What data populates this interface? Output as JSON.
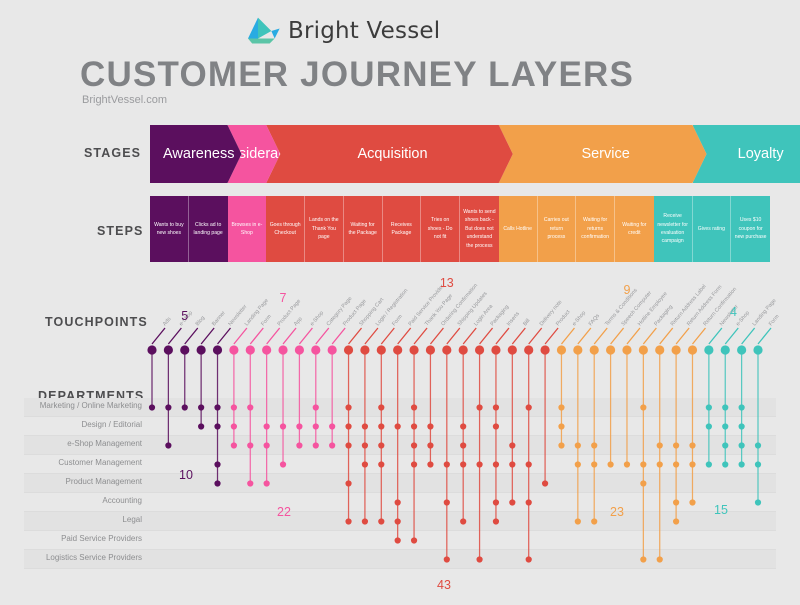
{
  "brand": {
    "logo_text": "Bright Vessel",
    "logo_icon": "sail-boat-icon"
  },
  "header": {
    "title": "CUSTOMER JOURNEY LAYERS",
    "subtitle": "BrightVessel.com"
  },
  "row_labels": {
    "stages": "STAGES",
    "steps": "STEPS",
    "touchpoints": "TOUCHPOINTS",
    "departments": "DEPARTMENTS"
  },
  "colors": {
    "awareness": "#5b0f5e",
    "consideration": "#f5549f",
    "acquisition": "#df4b41",
    "service": "#f2a04a",
    "loyalty": "#3fc4bb",
    "background": "#e8e8e8",
    "title_gray": "#808285",
    "text_gray": "#8d8e90"
  },
  "stages": [
    {
      "label": "Awareness",
      "color": "#5b0f5e",
      "steps": 2
    },
    {
      "label": "Consideration",
      "color": "#f5549f",
      "steps": 1
    },
    {
      "label": "Acquisition",
      "color": "#df4b41",
      "steps": 6
    },
    {
      "label": "Service",
      "color": "#f2a04a",
      "steps": 5
    },
    {
      "label": "Loyalty",
      "color": "#3fc4bb",
      "steps": 3
    }
  ],
  "steps": [
    {
      "label": "Wants to buy new shoes",
      "stage": 0
    },
    {
      "label": "Clicks ad to landing page",
      "stage": 0
    },
    {
      "label": "Browses in e-Shop",
      "stage": 1
    },
    {
      "label": "Goes through Checkout",
      "stage": 2
    },
    {
      "label": "Lands on the Thank You page",
      "stage": 2
    },
    {
      "label": "Waiting for the Package",
      "stage": 2
    },
    {
      "label": "Receives Package",
      "stage": 2
    },
    {
      "label": "Tries on shoes - Do not fit",
      "stage": 2
    },
    {
      "label": "Wants to send shoes back - But does not understand the process",
      "stage": 2
    },
    {
      "label": "Calls Hotline",
      "stage": 3
    },
    {
      "label": "Carries out return process",
      "stage": 3
    },
    {
      "label": "Waiting for returns confirmation",
      "stage": 3
    },
    {
      "label": "Waiting for credit",
      "stage": 3
    },
    {
      "label": "Receive newsletter for evaluation campaign",
      "stage": 4
    },
    {
      "label": "Gives rating",
      "stage": 4
    },
    {
      "label": "Uses $10 coupon for new purchase",
      "stage": 4
    }
  ],
  "touchpoint_counts": [
    {
      "stage": 0,
      "value": "5"
    },
    {
      "stage": 1,
      "value": "7"
    },
    {
      "stage": 2,
      "value": "13"
    },
    {
      "stage": 3,
      "value": "9"
    },
    {
      "stage": 4,
      "value": "4"
    }
  ],
  "department_counts": [
    {
      "stage": 0,
      "value": "10"
    },
    {
      "stage": 1,
      "value": "22"
    },
    {
      "stage": 2,
      "value": "43"
    },
    {
      "stage": 3,
      "value": "23"
    },
    {
      "stage": 4,
      "value": "15"
    }
  ],
  "departments": [
    "Marketing / Online Marketing",
    "Design / Editorial",
    "e-Shop Management",
    "Customer Management",
    "Product Management",
    "Accounting",
    "Legal",
    "Paid Service Providers",
    "Logistics Service Providers"
  ],
  "chart_data": {
    "type": "scatter",
    "title": "CUSTOMER JOURNEY LAYERS",
    "xlabel": "Touchpoints",
    "ylabel": "Departments",
    "grid": true,
    "legend": "none",
    "y_categories": [
      "Marketing / Online Marketing",
      "Design / Editorial",
      "e-Shop Management",
      "Customer Management",
      "Product Management",
      "Accounting",
      "Legal",
      "Paid Service Providers",
      "Logistics Service Providers"
    ],
    "series": [
      {
        "name": "Awareness",
        "color": "#5b0f5e",
        "count": 5,
        "department_links": 10
      },
      {
        "name": "Consideration",
        "color": "#f5549f",
        "count": 7,
        "department_links": 22
      },
      {
        "name": "Acquisition",
        "color": "#df4b41",
        "count": 13,
        "department_links": 43
      },
      {
        "name": "Service",
        "color": "#f2a04a",
        "count": 9,
        "department_links": 23
      },
      {
        "name": "Loyalty",
        "color": "#3fc4bb",
        "count": 4,
        "department_links": 15
      }
    ],
    "touchpoints": [
      {
        "label": "Ads",
        "stage": 0,
        "departments": [
          0
        ]
      },
      {
        "label": "e-Shop",
        "stage": 0,
        "departments": [
          0,
          2
        ]
      },
      {
        "label": "Blog",
        "stage": 0,
        "departments": [
          0
        ]
      },
      {
        "label": "Banner",
        "stage": 0,
        "departments": [
          0,
          1
        ]
      },
      {
        "label": "Newsletter",
        "stage": 0,
        "departments": [
          0,
          1,
          3,
          4
        ]
      },
      {
        "label": "Landing Page",
        "stage": 1,
        "departments": [
          0,
          1,
          2
        ]
      },
      {
        "label": "Form",
        "stage": 1,
        "departments": [
          0,
          2,
          4
        ]
      },
      {
        "label": "Product Page",
        "stage": 1,
        "departments": [
          1,
          2,
          4
        ]
      },
      {
        "label": "App",
        "stage": 1,
        "departments": [
          1,
          3
        ]
      },
      {
        "label": "e-Shop",
        "stage": 1,
        "departments": [
          1,
          2
        ]
      },
      {
        "label": "Category Page",
        "stage": 1,
        "departments": [
          0,
          1,
          2
        ]
      },
      {
        "label": "Product Page",
        "stage": 1,
        "departments": [
          1,
          2
        ]
      },
      {
        "label": "Shopping Cart",
        "stage": 2,
        "departments": [
          0,
          1,
          2,
          4,
          6
        ]
      },
      {
        "label": "Login / Registration",
        "stage": 2,
        "departments": [
          1,
          2,
          3,
          6
        ]
      },
      {
        "label": "Form",
        "stage": 2,
        "departments": [
          0,
          1,
          2,
          3,
          6
        ]
      },
      {
        "label": "Paid Service Provider",
        "stage": 2,
        "departments": [
          1,
          5,
          6,
          7
        ]
      },
      {
        "label": "Thank You Page",
        "stage": 2,
        "departments": [
          0,
          1,
          2,
          3,
          7
        ]
      },
      {
        "label": "Ordering Confirmation",
        "stage": 2,
        "departments": [
          1,
          2,
          3
        ]
      },
      {
        "label": "Shipping Updates",
        "stage": 2,
        "departments": [
          3,
          5,
          8
        ]
      },
      {
        "label": "Login Area",
        "stage": 2,
        "departments": [
          1,
          2,
          3,
          6
        ]
      },
      {
        "label": "Packaging",
        "stage": 2,
        "departments": [
          0,
          3,
          8
        ]
      },
      {
        "label": "Inserts",
        "stage": 2,
        "departments": [
          0,
          1,
          3,
          5,
          6
        ]
      },
      {
        "label": "Bill",
        "stage": 2,
        "departments": [
          2,
          3,
          5
        ]
      },
      {
        "label": "Delivery note",
        "stage": 2,
        "departments": [
          0,
          3,
          5,
          8
        ]
      },
      {
        "label": "Product",
        "stage": 2,
        "departments": [
          4
        ]
      },
      {
        "label": "e-Shop",
        "stage": 3,
        "departments": [
          0,
          1,
          2
        ]
      },
      {
        "label": "FAQs",
        "stage": 3,
        "departments": [
          2,
          3,
          6
        ]
      },
      {
        "label": "Terms & Conditions",
        "stage": 3,
        "departments": [
          2,
          3,
          6
        ]
      },
      {
        "label": "Speech Computer",
        "stage": 3,
        "departments": [
          3
        ]
      },
      {
        "label": "Hotline Employee",
        "stage": 3,
        "departments": [
          3
        ]
      },
      {
        "label": "Packaging",
        "stage": 3,
        "departments": [
          0,
          3,
          4,
          8
        ]
      },
      {
        "label": "Return Address Label",
        "stage": 3,
        "departments": [
          2,
          3,
          8
        ]
      },
      {
        "label": "Return Address Form",
        "stage": 3,
        "departments": [
          2,
          3,
          5,
          6
        ]
      },
      {
        "label": "Return Confirmation",
        "stage": 3,
        "departments": [
          2,
          3,
          5
        ]
      },
      {
        "label": "Newsletter",
        "stage": 4,
        "departments": [
          0,
          1,
          3
        ]
      },
      {
        "label": "e-Shop",
        "stage": 4,
        "departments": [
          0,
          1,
          2,
          3
        ]
      },
      {
        "label": "Landing Page",
        "stage": 4,
        "departments": [
          0,
          1,
          2,
          3
        ]
      },
      {
        "label": "Form",
        "stage": 4,
        "departments": [
          2,
          3,
          5
        ]
      }
    ]
  }
}
